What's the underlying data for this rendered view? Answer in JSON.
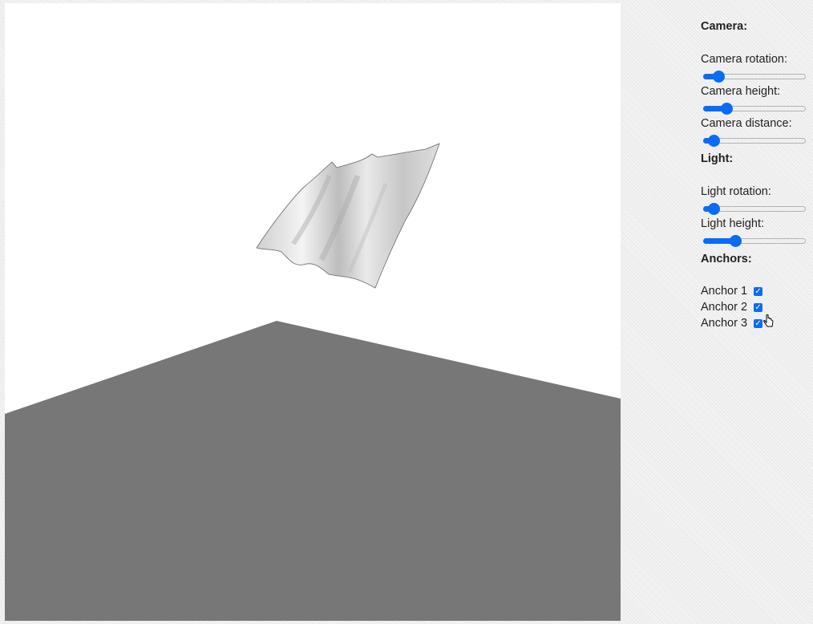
{
  "camera": {
    "title": "Camera:",
    "sliders": [
      {
        "label": "Camera rotation:",
        "value": 0.15
      },
      {
        "label": "Camera height:",
        "value": 0.23
      },
      {
        "label": "Camera distance:",
        "value": 0.1
      }
    ]
  },
  "light": {
    "title": "Light:",
    "sliders": [
      {
        "label": "Light rotation:",
        "value": 0.1
      },
      {
        "label": "Light height:",
        "value": 0.31
      }
    ]
  },
  "anchors": {
    "title": "Anchors:",
    "items": [
      {
        "label": "Anchor 1",
        "checked": true
      },
      {
        "label": "Anchor 2",
        "checked": true
      },
      {
        "label": "Anchor 3",
        "checked": true
      }
    ]
  },
  "colors": {
    "accent": "#0a6cf5",
    "ground": "#777777",
    "background": "#ffffff",
    "cloth": "#d9d9d9"
  },
  "icons": {
    "cursor": "hand-pointer-icon",
    "check": "checkmark-icon"
  }
}
